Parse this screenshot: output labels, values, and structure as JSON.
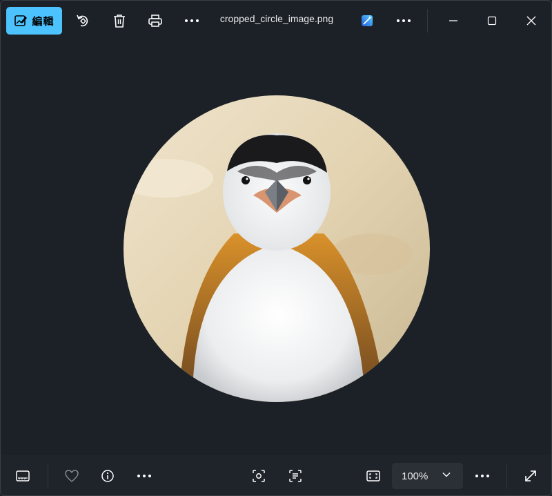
{
  "toolbar": {
    "edit_label": "編輯",
    "filename": "cropped_circle_image.png"
  },
  "bottom": {
    "zoom_value": "100%"
  },
  "icons": {
    "edit": "edit-image-icon",
    "rotate": "rotate-icon",
    "delete": "trash-icon",
    "print": "print-icon",
    "more": "more-dots-icon",
    "designer": "magic-edit-icon",
    "minimize": "minimize-icon",
    "maximize": "maximize-icon",
    "close": "close-icon",
    "filmstrip": "filmstrip-icon",
    "favorite": "heart-icon",
    "info": "info-icon",
    "visual_search": "visual-search-icon",
    "text_scan": "text-scan-icon",
    "fit": "fit-to-window-icon",
    "chevron": "chevron-down-icon",
    "fullscreen": "fullscreen-icon"
  },
  "colors": {
    "accent": "#4cc2ff",
    "background": "#1c2127"
  }
}
